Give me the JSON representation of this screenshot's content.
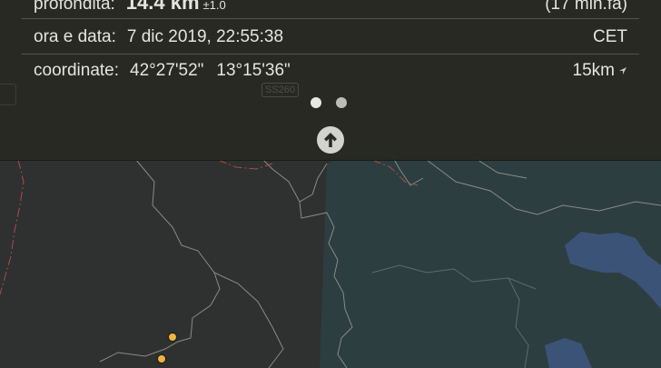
{
  "details": {
    "depth": {
      "label": "profondità:",
      "value": "14.4 km",
      "uncertainty": "±1.0",
      "ago": "(17 min.fa)"
    },
    "datetime": {
      "label": "ora e data:",
      "value": "7 dic 2019, 22:55:38",
      "timezone": "CET"
    },
    "coords": {
      "label": "coordinate:",
      "lat": "42°27'52\"",
      "lon": "13°15'36\"",
      "distance": "15km"
    }
  },
  "pager": {
    "count": 2,
    "active_index": 0
  },
  "map": {
    "ghost_label": "SS260",
    "colors": {
      "land": "#2f3030",
      "sea": "#2c3e40",
      "lake": "#3c5378",
      "border": "#8a8a86",
      "region_border": "#b04a4a",
      "quake": "#f0b43c"
    },
    "markers": [
      {
        "type": "earthquake"
      },
      {
        "type": "earthquake"
      }
    ]
  }
}
